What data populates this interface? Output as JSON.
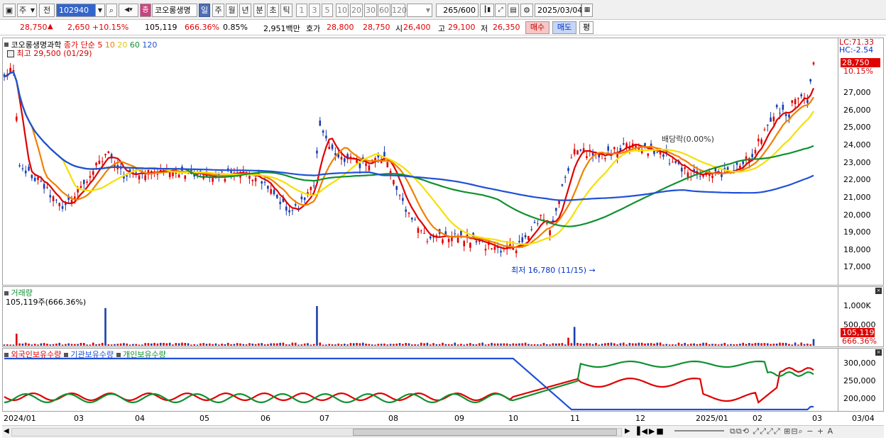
{
  "toolbar": {
    "type_select": "주",
    "prev_label": "전",
    "code_value": "102940",
    "stock_name": "코오롱생명",
    "stock_icon_label": "종",
    "periods": [
      "일",
      "주",
      "월",
      "년",
      "분",
      "초",
      "틱"
    ],
    "active_period": "일",
    "intervals": [
      "1",
      "3",
      "5",
      "10",
      "20",
      "30",
      "60",
      "120"
    ],
    "count_value": "265",
    "count_max": "/600",
    "date_value": "2025/03/04"
  },
  "info": {
    "price": "28,750",
    "change": "2,650",
    "change_rate": "+10.15%",
    "volume": "105,119",
    "volume_rate": "666.36%",
    "turnover": "0.85%",
    "amount": "2,951백만",
    "bid_label": "호가",
    "bid_value": "28,800",
    "open_value": "28,750",
    "open_label": "시",
    "open_price": "26,400",
    "high_label": "고",
    "high_price": "29,100",
    "low_label": "저",
    "low_price": "26,350",
    "buy_label": "매수",
    "sell_label": "매도",
    "eval_label": "평"
  },
  "price_panel": {
    "name": "코오롱생명과학",
    "indicator_label": "종가 단순",
    "ma_labels": [
      "5",
      "10",
      "20",
      "60",
      "120"
    ],
    "max_label": "최고 29,500 (01/29)",
    "min_label": "최저 16,780 (11/15)",
    "dividend_label": "배당락(0.00%)",
    "lc_label": "LC:71.33",
    "hc_label": "HC:-2.54",
    "current_price_tag": "28,750",
    "current_rate_tag": "10.15%",
    "y_ticks": [
      "27,000",
      "26,000",
      "25,000",
      "24,000",
      "23,000",
      "22,000",
      "21,000",
      "20,000",
      "19,000",
      "18,000",
      "17,000"
    ]
  },
  "volume_panel": {
    "title": "거래량",
    "value_label": "105,119주(666.36%)",
    "y_ticks": [
      "1,000K",
      "500,000"
    ],
    "current_tag": "105,119",
    "current_rate_tag": "666.36%"
  },
  "holding_panel": {
    "legends": [
      "외국인보유수량",
      "기관보유수량",
      "개인보유수량"
    ],
    "y_ticks": [
      "300,000",
      "250,000",
      "200,000"
    ]
  },
  "x_ticks": [
    "2024/01",
    "03",
    "04",
    "05",
    "06",
    "07",
    "08",
    "09",
    "10",
    "11",
    "12",
    "2025/01",
    "02",
    "03",
    "03/04"
  ],
  "colors": {
    "up": "#e00000",
    "down": "#1a3fb0",
    "ma5": "#e00000",
    "ma10": "#f08000",
    "ma20": "#f5e000",
    "ma60": "#109030",
    "ma120": "#2050d8"
  }
}
